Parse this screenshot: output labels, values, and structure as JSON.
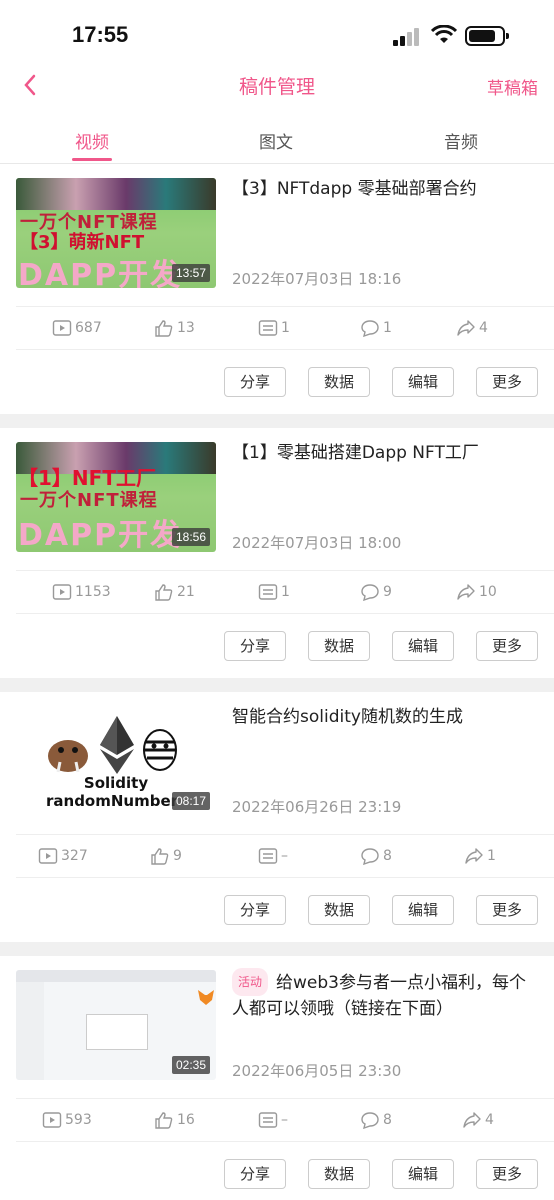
{
  "status_bar": {
    "time": "17:55"
  },
  "header": {
    "title": "稿件管理",
    "drafts_label": "草稿箱"
  },
  "tabs": [
    {
      "label": "视频",
      "active": true
    },
    {
      "label": "图文",
      "active": false
    },
    {
      "label": "音频",
      "active": false
    }
  ],
  "accent_color": "#f0578a",
  "videos": [
    {
      "title": "【3】NFTdapp 零基础部署合约",
      "duration": "13:57",
      "date": "2022年07月03日 18:16",
      "stats": {
        "plays": "687",
        "likes": "13",
        "coins": "1",
        "comments": "1",
        "shares": "4"
      },
      "thumb_text": {
        "line1": "一万个NFT课程",
        "line2": "【3】萌新NFT",
        "line3": "DAPP开发"
      }
    },
    {
      "title": "【1】零基础搭建Dapp NFT工厂",
      "duration": "18:56",
      "date": "2022年07月03日 18:00",
      "stats": {
        "plays": "1153",
        "likes": "21",
        "coins": "1",
        "comments": "9",
        "shares": "10"
      },
      "thumb_text": {
        "line1": "【1】NFT工厂",
        "line2": "一万个NFT课程",
        "line3": "DAPP开发"
      }
    },
    {
      "title": "智能合约solidity随机数的生成",
      "duration": "08:17",
      "date": "2022年06月26日 23:19",
      "stats": {
        "plays": "327",
        "likes": "9",
        "coins": "–",
        "comments": "8",
        "shares": "1"
      },
      "thumb_text": {
        "line1": "Solidity",
        "line2": "randomNumber"
      }
    },
    {
      "badge": "活动",
      "title": "给web3参与者一点小福利，每个人都可以领哦（链接在下面）",
      "duration": "02:35",
      "date": "2022年06月05日 23:30",
      "stats": {
        "plays": "593",
        "likes": "16",
        "coins": "–",
        "comments": "8",
        "shares": "4"
      }
    }
  ],
  "actions": {
    "share": "分享",
    "data": "数据",
    "edit": "编辑",
    "more": "更多"
  }
}
